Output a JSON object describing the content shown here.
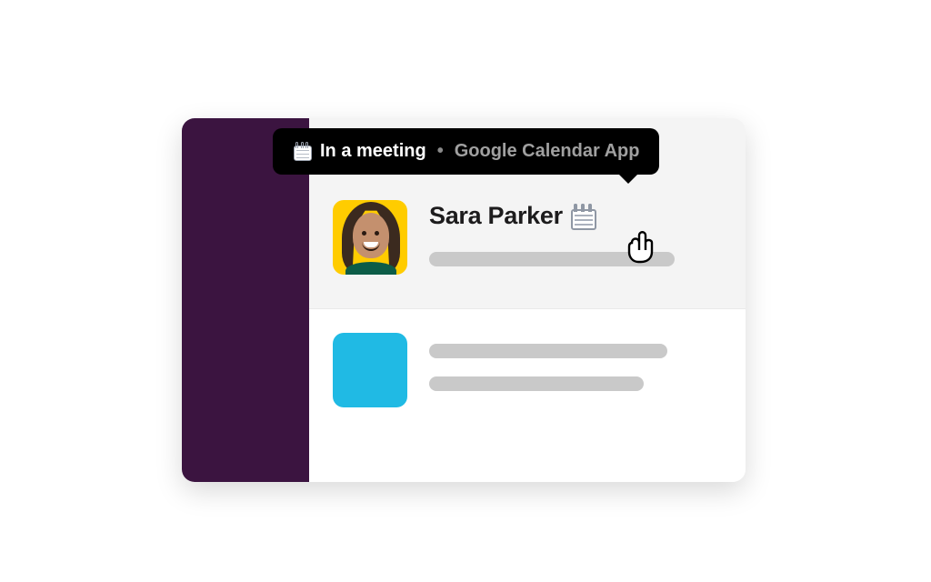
{
  "tooltip": {
    "icon_name": "calendar-icon",
    "status_text": "In a meeting",
    "separator": "•",
    "source_label": "Google Calendar App"
  },
  "messages": [
    {
      "author_name": "Sara Parker",
      "avatar_kind": "photo",
      "status_icon": "calendar-icon"
    },
    {
      "author_name": "",
      "avatar_kind": "blue",
      "status_icon": ""
    }
  ],
  "colors": {
    "sidebar": "#3B1440",
    "tooltip_bg": "#000000",
    "accent_blue": "#20BAE4",
    "avatar_bg": "#FFCC00"
  }
}
